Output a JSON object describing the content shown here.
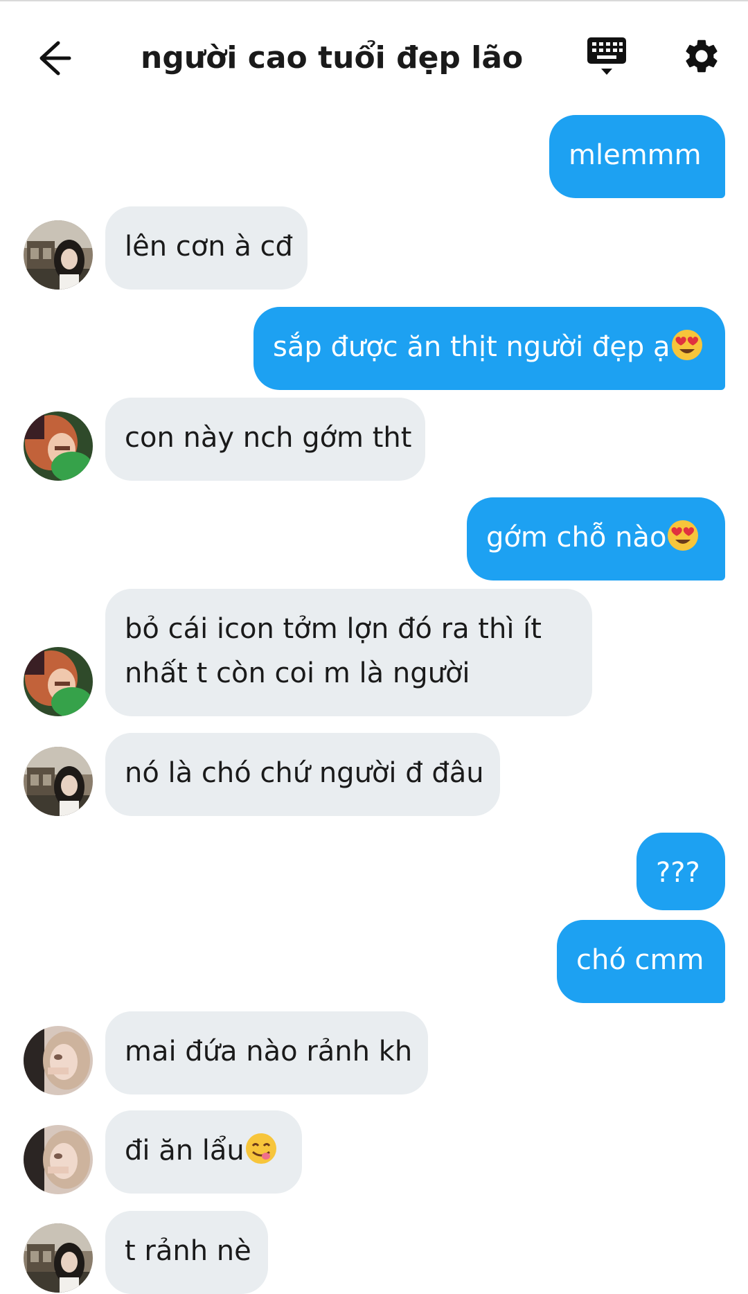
{
  "header": {
    "title": "người cao tuổi đẹp lão",
    "back_icon": "arrow-left-icon",
    "keyboard_icon": "keyboard-icon",
    "settings_icon": "gear-icon"
  },
  "colors": {
    "outgoing_bubble": "#1da1f2",
    "incoming_bubble": "#e9edf0",
    "text_dark": "#1a1a1a"
  },
  "messages": [
    {
      "dir": "out",
      "text": "mlemmm"
    },
    {
      "dir": "in",
      "avatar": "avatar-a",
      "text": "lên cơn à cđ"
    },
    {
      "dir": "out",
      "text": "sắp được ăn thịt người đẹp ạ",
      "emoji": "heart-eyes-emoji"
    },
    {
      "dir": "in",
      "avatar": "avatar-b",
      "text": "con này nch gớm tht"
    },
    {
      "dir": "out",
      "text": "gớm chỗ nào",
      "emoji": "heart-eyes-emoji"
    },
    {
      "dir": "in",
      "avatar": "avatar-b",
      "text_line1": "bỏ cái icon tởm lợn đó ra thì ít",
      "text_line2": "nhất t còn coi m là người"
    },
    {
      "dir": "in",
      "avatar": "avatar-a",
      "text": "nó là chó chứ người đ đâu"
    },
    {
      "dir": "out",
      "text": "???"
    },
    {
      "dir": "out",
      "text": "chó cmm"
    },
    {
      "dir": "in",
      "avatar": "avatar-c",
      "text": "mai đứa nào rảnh kh"
    },
    {
      "dir": "in",
      "avatar": "avatar-c",
      "text": "đi ăn lẩu",
      "emoji": "yum-emoji"
    },
    {
      "dir": "in",
      "avatar": "avatar-a",
      "text": "t rảnh nè"
    }
  ]
}
